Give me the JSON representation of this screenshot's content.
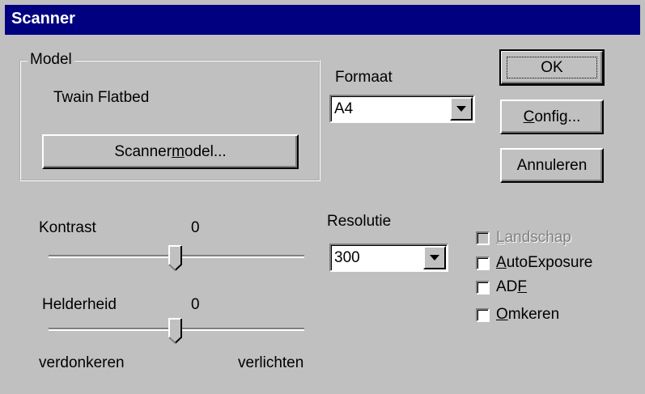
{
  "window": {
    "title": "Scanner"
  },
  "model_group": {
    "legend": "Model",
    "model_name": "Twain Flatbed",
    "button_pre": "Scanner",
    "button_accel": "m",
    "button_post": "odel..."
  },
  "formaat": {
    "label": "Formaat",
    "selected": "A4"
  },
  "resolutie": {
    "label": "Resolutie",
    "selected": "300"
  },
  "buttons": {
    "ok": "OK",
    "config_accel": "C",
    "config_rest": "onfig...",
    "cancel": "Annuleren"
  },
  "kontrast": {
    "label": "Kontrast",
    "value": "0"
  },
  "helderheid": {
    "label": "Helderheid",
    "value": "0"
  },
  "slider_scale": {
    "min_label": "verdonkeren",
    "max_label": "verlichten"
  },
  "options": {
    "landschap": {
      "accel": "L",
      "rest": "andschap",
      "checked": false,
      "enabled": false
    },
    "autoexposure": {
      "accel": "A",
      "rest": "utoExposure",
      "checked": false,
      "enabled": true
    },
    "adf": {
      "pre": "AD",
      "accel": "F",
      "checked": false,
      "enabled": true
    },
    "omkeren": {
      "accel": "O",
      "rest": "mkeren",
      "checked": false,
      "enabled": true
    }
  },
  "colors": {
    "title_bar": "#000080",
    "face": "#c0c0c0",
    "disabled_text": "#808080"
  }
}
